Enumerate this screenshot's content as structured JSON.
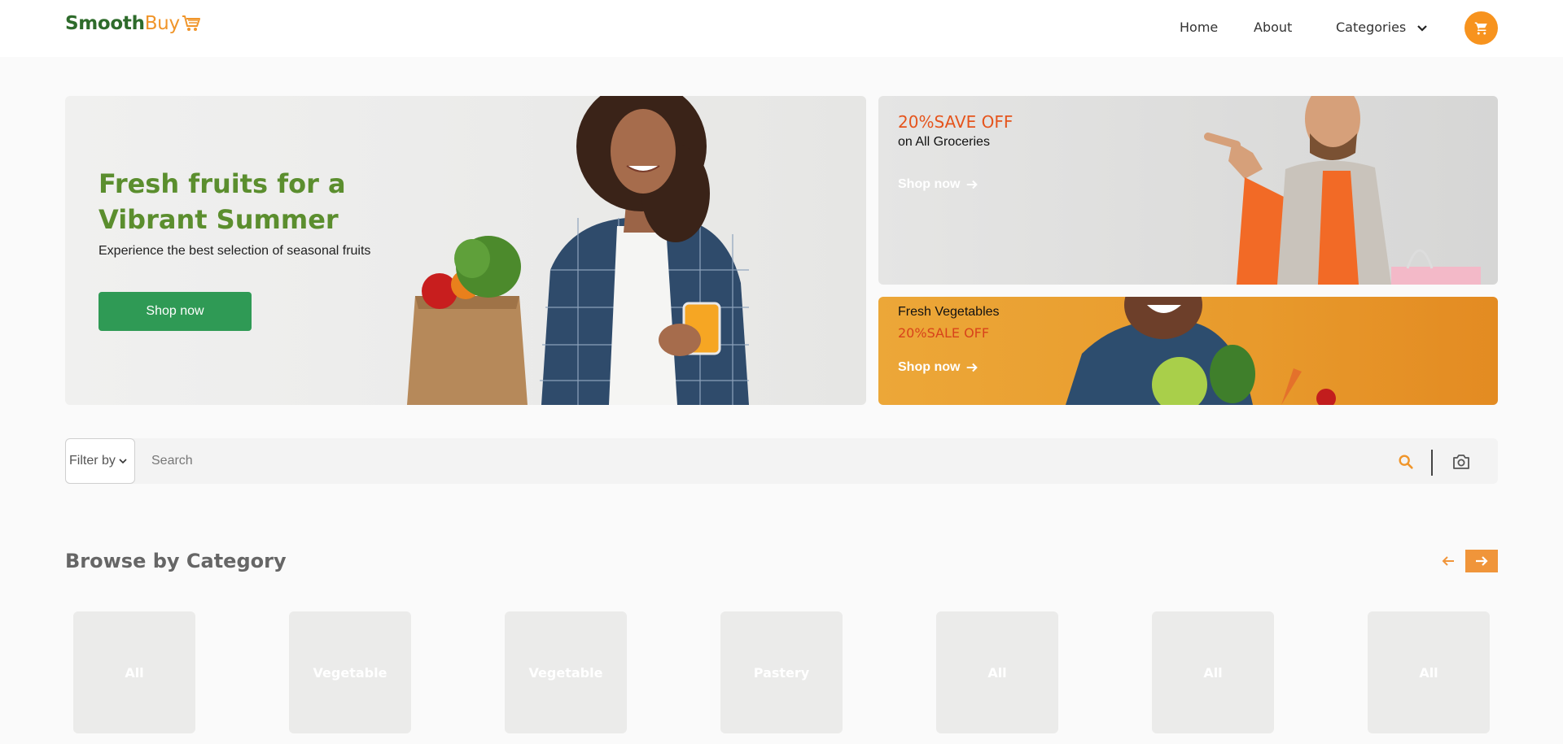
{
  "brand": {
    "part1": "Smooth",
    "part2": "Buy"
  },
  "nav": {
    "home": "Home",
    "about": "About",
    "categories": "Categories"
  },
  "hero": {
    "title": "Fresh fruits for a Vibrant Summer",
    "subtitle": "Experience the best selection of seasonal fruits",
    "cta": "Shop now"
  },
  "promo1": {
    "headline": "20%SAVE OFF",
    "sub": "on All Groceries",
    "cta": "Shop now"
  },
  "promo2": {
    "title": "Fresh Vegetables",
    "headline": "20%SALE OFF",
    "cta": "Shop now"
  },
  "search": {
    "filter_label": "Filter by",
    "placeholder": "Search"
  },
  "browse": {
    "title": "Browse by Category",
    "categories": [
      "All",
      "Vegetable",
      "Vegetable",
      "Pastery",
      "All",
      "All",
      "All"
    ]
  },
  "colors": {
    "brand_green": "#2e6b2b",
    "accent_orange": "#f7931e",
    "hero_green": "#5b8e2e",
    "cta_green": "#2f9a55",
    "promo_red": "#e5541c"
  },
  "icons": [
    "cart-icon",
    "chevron-down-icon",
    "arrow-right-icon",
    "search-icon",
    "camera-icon",
    "arrow-left-icon"
  ]
}
